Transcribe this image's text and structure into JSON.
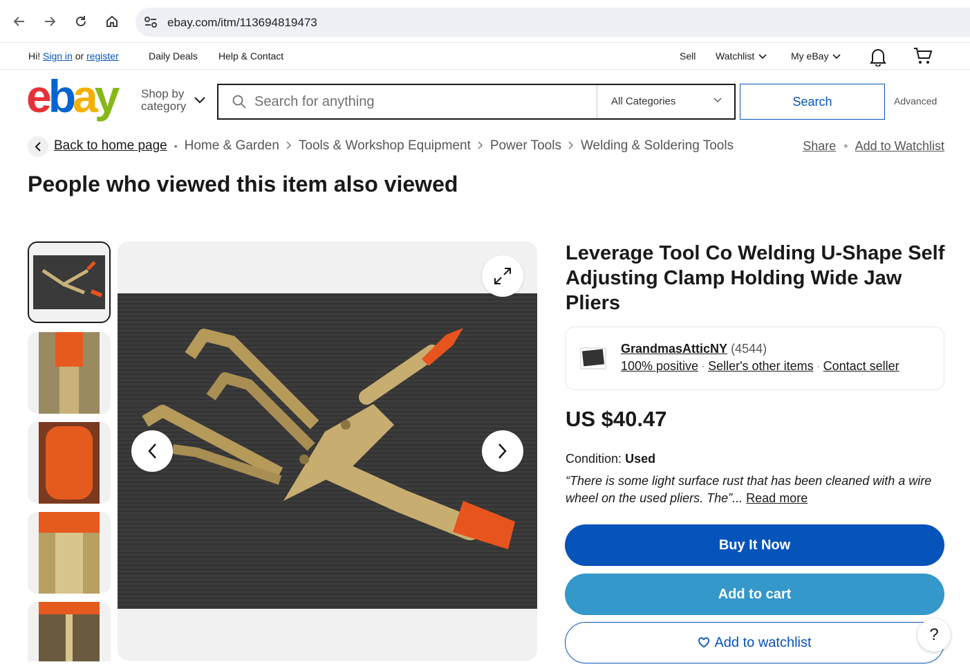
{
  "browser": {
    "url": "ebay.com/itm/113694819473"
  },
  "top_strip": {
    "greeting": "Hi!",
    "sign_in": "Sign in",
    "or": "or",
    "register": "register",
    "daily_deals": "Daily Deals",
    "help_contact": "Help & Contact",
    "sell": "Sell",
    "watchlist": "Watchlist",
    "my_ebay": "My eBay"
  },
  "header": {
    "shop_by_line1": "Shop by",
    "shop_by_line2": "category",
    "search_placeholder": "Search for anything",
    "category": "All Categories",
    "search_button": "Search",
    "advanced": "Advanced"
  },
  "breadcrumb": {
    "back": "Back to home page",
    "items": [
      "Home & Garden",
      "Tools & Workshop Equipment",
      "Power Tools",
      "Welding & Soldering Tools"
    ],
    "share": "Share",
    "add_watchlist": "Add to Watchlist"
  },
  "section_title": "People who viewed this item also viewed",
  "item": {
    "title": "Leverage Tool Co Welding U-Shape Self Adjusting Clamp Holding Wide Jaw Pliers",
    "seller_name": "GrandmasAtticNY",
    "seller_feedback": "(4544)",
    "positive": "100% positive",
    "other_items": "Seller's other items",
    "contact": "Contact seller",
    "price": "US $40.47",
    "condition_label": "Condition:",
    "condition_value": "Used",
    "condition_quote": "“There is some light surface rust that has been cleaned with a wire wheel on the used pliers. The”...",
    "read_more": "Read more",
    "buy_now": "Buy It Now",
    "add_cart": "Add to cart",
    "add_watch": "Add to watchlist"
  },
  "help_fab": "?",
  "colors": {
    "accent": "#0654ba",
    "cart": "#3498ca"
  }
}
